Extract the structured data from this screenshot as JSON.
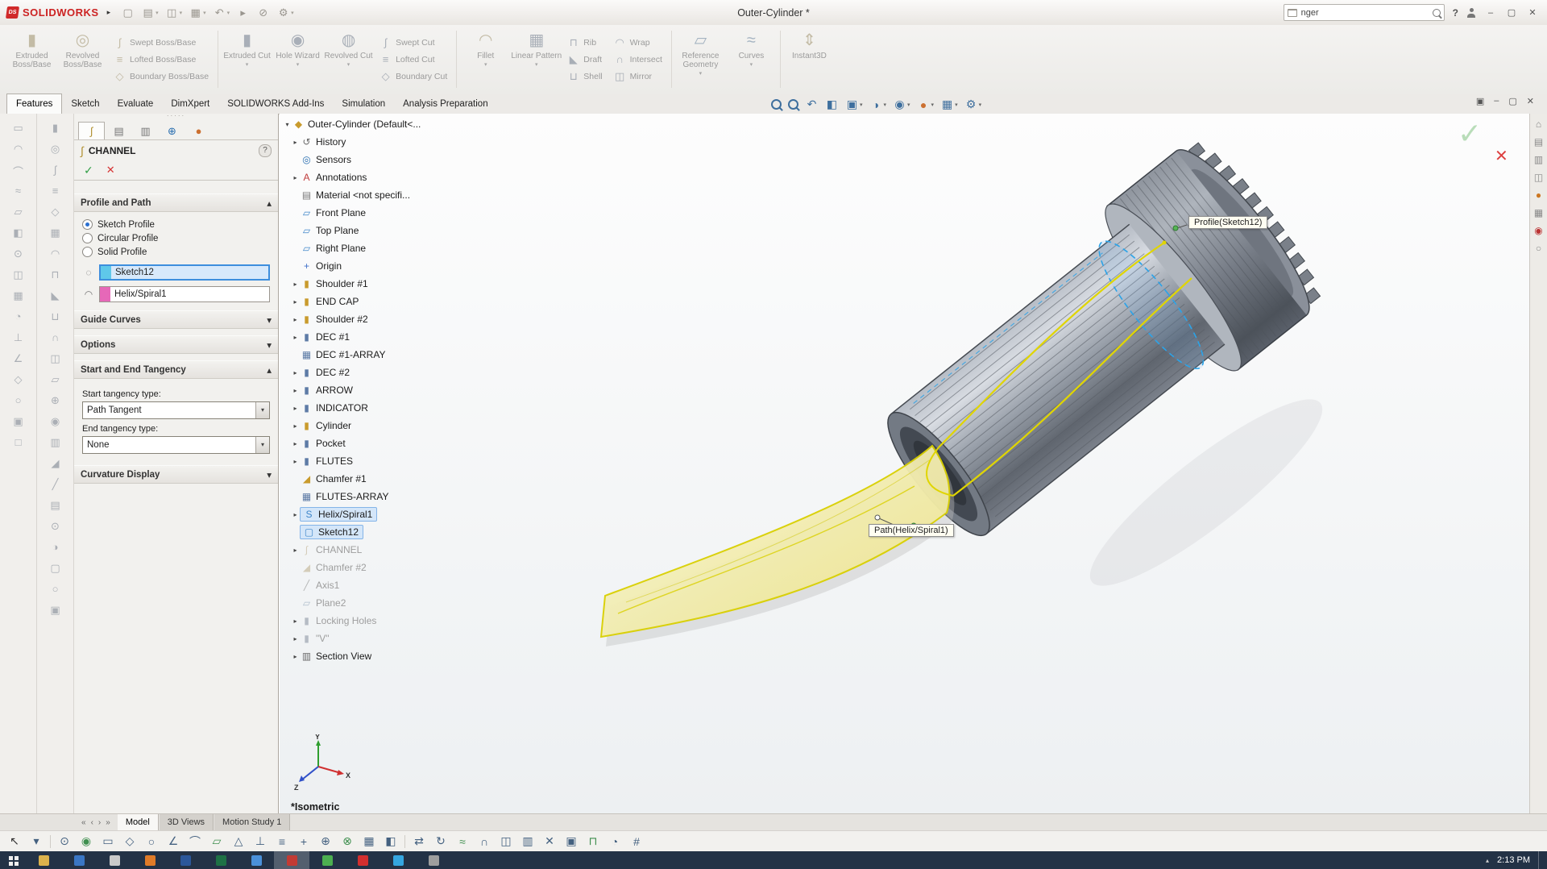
{
  "titlebar": {
    "logo": "SOLIDWORKS",
    "logo_mark": "DS",
    "title": "Outer-Cylinder *",
    "search_value": "nger",
    "help": "?"
  },
  "quick_access": [
    "new-icon",
    "open-icon",
    "save-icon",
    "print-icon",
    "undo-icon",
    "select-icon",
    "attachment-icon",
    "options-gear-icon"
  ],
  "command_tabs": {
    "active": "Features",
    "items": [
      "Features",
      "Sketch",
      "Evaluate",
      "DimXpert",
      "SOLIDWORKS Add-Ins",
      "Simulation",
      "Analysis Preparation"
    ]
  },
  "ribbon": [
    {
      "type": "large",
      "label": "Extruded Boss/Base",
      "icon": "extruded-boss"
    },
    {
      "type": "large",
      "label": "Revolved Boss/Base",
      "icon": "revolved-boss"
    },
    {
      "type": "stack",
      "buttons": [
        {
          "label": "Swept Boss/Base",
          "icon": "swept-boss"
        },
        {
          "label": "Lofted Boss/Base",
          "icon": "lofted-boss"
        },
        {
          "label": "Boundary Boss/Base",
          "icon": "boundary-boss"
        }
      ]
    },
    {
      "type": "large",
      "label": "Extruded Cut",
      "icon": "extruded-cut",
      "arrow": true
    },
    {
      "type": "large",
      "label": "Hole Wizard",
      "icon": "hole-wizard",
      "arrow": true
    },
    {
      "type": "large",
      "label": "Revolved Cut",
      "icon": "revolved-cut",
      "arrow": true
    },
    {
      "type": "stack",
      "buttons": [
        {
          "label": "Swept Cut",
          "icon": "swept-cut"
        },
        {
          "label": "Lofted Cut",
          "icon": "lofted-cut"
        },
        {
          "label": "Boundary Cut",
          "icon": "boundary-cut"
        }
      ]
    },
    {
      "type": "large",
      "label": "Fillet",
      "icon": "fillet",
      "arrow": true
    },
    {
      "type": "large",
      "label": "Linear Pattern",
      "icon": "linear-pattern",
      "arrow": true
    },
    {
      "type": "stack",
      "buttons": [
        {
          "label": "Rib",
          "icon": "rib"
        },
        {
          "label": "Draft",
          "icon": "draft"
        },
        {
          "label": "Shell",
          "icon": "shell"
        }
      ]
    },
    {
      "type": "stack",
      "buttons": [
        {
          "label": "Wrap",
          "icon": "wrap"
        },
        {
          "label": "Intersect",
          "icon": "intersect"
        },
        {
          "label": "Mirror",
          "icon": "mirror"
        }
      ]
    },
    {
      "type": "large",
      "label": "Reference Geometry",
      "icon": "reference-geometry",
      "arrow": true
    },
    {
      "type": "large",
      "label": "Curves",
      "icon": "curves",
      "arrow": true
    },
    {
      "type": "large",
      "label": "Instant3D",
      "icon": "instant3d"
    }
  ],
  "view_toolbar": [
    "zoom-fit-icon",
    "zoom-area-icon",
    "previous-view-icon",
    "section-view-icon",
    "view-orientation-icon",
    "display-style-icon",
    "hide-show-icon",
    "appearance-icon",
    "scene-icon",
    "view-settings-icon"
  ],
  "property_manager": {
    "title": "CHANNEL",
    "help": "?",
    "groups": {
      "profile_path": {
        "label": "Profile and Path",
        "radios": [
          {
            "label": "Sketch Profile",
            "checked": true
          },
          {
            "label": "Circular Profile",
            "checked": false
          },
          {
            "label": "Solid Profile",
            "checked": false
          }
        ],
        "profile_value": "Sketch12",
        "path_value": "Helix/Spiral1"
      },
      "guide_curves": {
        "label": "Guide Curves"
      },
      "options": {
        "label": "Options"
      },
      "tangency": {
        "label": "Start and End Tangency",
        "start_label": "Start tangency type:",
        "start_value": "Path Tangent",
        "end_label": "End tangency type:",
        "end_value": "None"
      },
      "curvature": {
        "label": "Curvature Display"
      }
    }
  },
  "feature_tree": {
    "root": "Outer-Cylinder (Default<...",
    "items": [
      {
        "label": "History",
        "icon": "history",
        "expand": true
      },
      {
        "label": "Sensors",
        "icon": "sensors",
        "expand": false
      },
      {
        "label": "Annotations",
        "icon": "annotations",
        "expand": true
      },
      {
        "label": "Material <not specifi...",
        "icon": "material",
        "expand": false
      },
      {
        "label": "Front Plane",
        "icon": "plane",
        "expand": false
      },
      {
        "label": "Top Plane",
        "icon": "plane",
        "expand": false
      },
      {
        "label": "Right Plane",
        "icon": "plane",
        "expand": false
      },
      {
        "label": "Origin",
        "icon": "origin",
        "expand": false
      },
      {
        "label": "Shoulder #1",
        "icon": "boss",
        "expand": true
      },
      {
        "label": "END CAP",
        "icon": "boss",
        "expand": true
      },
      {
        "label": "Shoulder #2",
        "icon": "boss",
        "expand": true
      },
      {
        "label": "DEC #1",
        "icon": "cut",
        "expand": true
      },
      {
        "label": "DEC #1-ARRAY",
        "icon": "pattern",
        "expand": false
      },
      {
        "label": "DEC #2",
        "icon": "cut",
        "expand": true
      },
      {
        "label": "ARROW",
        "icon": "cut",
        "expand": true
      },
      {
        "label": "INDICATOR",
        "icon": "cut",
        "expand": true
      },
      {
        "label": "Cylinder",
        "icon": "boss",
        "expand": true
      },
      {
        "label": "Pocket",
        "icon": "cut",
        "expand": true
      },
      {
        "label": "FLUTES",
        "icon": "cut",
        "expand": true
      },
      {
        "label": "Chamfer #1",
        "icon": "chamfer",
        "expand": false
      },
      {
        "label": "FLUTES-ARRAY",
        "icon": "pattern",
        "expand": false
      },
      {
        "label": "Helix/Spiral1",
        "icon": "helix",
        "expand": true,
        "selected": true
      },
      {
        "label": "Sketch12",
        "icon": "sketch",
        "expand": false,
        "selected": true
      },
      {
        "label": "CHANNEL",
        "icon": "sweep",
        "expand": true,
        "dim": true
      },
      {
        "label": "Chamfer #2",
        "icon": "chamfer",
        "expand": false,
        "dim": true
      },
      {
        "label": "Axis1",
        "icon": "axis",
        "expand": false,
        "dim": true
      },
      {
        "label": "Plane2",
        "icon": "plane",
        "expand": false,
        "dim": true
      },
      {
        "label": "Locking Holes",
        "icon": "cut",
        "expand": true,
        "dim": true
      },
      {
        "label": "\"V\"",
        "icon": "cut",
        "expand": true,
        "dim": true
      },
      {
        "label": "Section View",
        "icon": "section",
        "expand": true
      }
    ]
  },
  "viewport": {
    "profile_callout": "Profile(Sketch12)",
    "path_callout": "Path(Helix/Spiral1)",
    "view_label": "*Isometric",
    "axis_x": "X",
    "axis_y": "Y",
    "axis_z": "Z"
  },
  "task_pane": [
    "home-icon",
    "design-library-icon",
    "file-explorer-icon",
    "view-palette-icon",
    "appearances-icon",
    "custom-properties-icon",
    "forum-icon",
    "resources-icon"
  ],
  "doc_tabs": {
    "active": "Model",
    "items": [
      "Model",
      "3D Views",
      "Motion Study 1"
    ]
  },
  "taskbar": {
    "time": "2:13 PM",
    "apps": [
      {
        "color": "#dcb24c"
      },
      {
        "color": "#3a76c4"
      },
      {
        "color": "#c9c9c9"
      },
      {
        "color": "#e07b28"
      },
      {
        "color": "#2b579a"
      },
      {
        "color": "#1e7145"
      },
      {
        "color": "#4a90d9"
      },
      {
        "color": "#c23b34",
        "active": true
      },
      {
        "color": "#4caf50"
      },
      {
        "color": "#d32f2f"
      },
      {
        "color": "#35a6e0"
      },
      {
        "color": "#9e9e9e"
      }
    ]
  }
}
